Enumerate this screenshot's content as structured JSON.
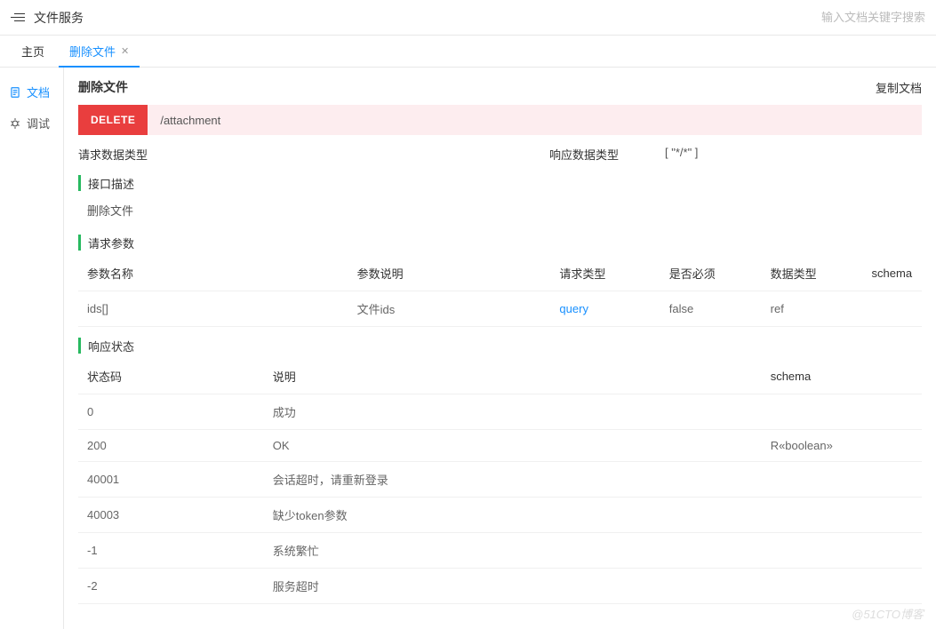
{
  "header": {
    "title": "文件服务",
    "search_placeholder": "输入文档关键字搜索"
  },
  "tabs": [
    {
      "label": "主页",
      "active": false,
      "closable": false
    },
    {
      "label": "删除文件",
      "active": true,
      "closable": true
    }
  ],
  "sidebar": [
    {
      "label": "文档",
      "active": true,
      "icon": "doc"
    },
    {
      "label": "调试",
      "active": false,
      "icon": "bug"
    }
  ],
  "doc": {
    "title": "删除文件",
    "copy_label": "复制文档",
    "method": "DELETE",
    "path": "/attachment",
    "request_type_label": "请求数据类型",
    "request_type_value": "",
    "response_type_label": "响应数据类型",
    "response_type_value": "[ \"*/*\" ]",
    "desc_title": "接口描述",
    "desc_text": "删除文件",
    "params_title": "请求参数",
    "params_headers": [
      "参数名称",
      "参数说明",
      "请求类型",
      "是否必须",
      "数据类型",
      "schema"
    ],
    "params_rows": [
      {
        "name": "ids[]",
        "desc": "文件ids",
        "req_type": "query",
        "required": "false",
        "dtype": "ref",
        "schema": ""
      }
    ],
    "status_title": "响应状态",
    "status_headers": [
      "状态码",
      "说明",
      "schema"
    ],
    "status_rows": [
      {
        "code": "0",
        "desc": "成功",
        "schema": ""
      },
      {
        "code": "200",
        "desc": "OK",
        "schema": "R«boolean»"
      },
      {
        "code": "40001",
        "desc": "会话超时，请重新登录",
        "schema": ""
      },
      {
        "code": "40003",
        "desc": "缺少token参数",
        "schema": ""
      },
      {
        "code": "-1",
        "desc": "系统繁忙",
        "schema": ""
      },
      {
        "code": "-2",
        "desc": "服务超时",
        "schema": ""
      }
    ]
  },
  "watermark": "@51CTO博客"
}
